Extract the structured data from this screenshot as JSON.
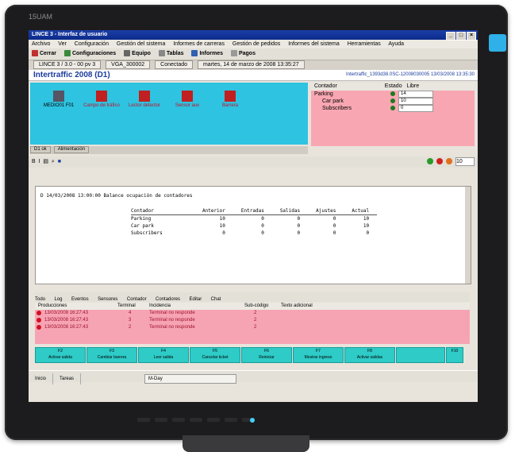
{
  "bezel_brand": "15UAM",
  "window": {
    "title": "LINCE 3 - Interfaz de usuario",
    "controls": [
      "_",
      "□",
      "×"
    ]
  },
  "menu": [
    "Archivo",
    "Ver",
    "Configuración",
    "Gestión del sistema",
    "Informes de carreras",
    "Gestión de pedidos",
    "Informes del sistema",
    "Herramientas",
    "Ayuda"
  ],
  "toolbar": {
    "items": [
      "Cerrar",
      "Configuraciones",
      "Equipo",
      "Tablas",
      "Informes",
      "Pagos"
    ]
  },
  "status_fields": [
    "LINCE 3 / 3.0 - 00 pv 3",
    "VGA_300002",
    "Conectado",
    "martes, 14 de marzo de 2008 13:35:27"
  ],
  "header": {
    "project_title": "Intertraffic 2008 (D1)",
    "project_id": "Intertraffic_1393d38.0SC-12008030005 13/03/2008 13:35:30"
  },
  "devices": [
    {
      "label": "MEDIO01 F01",
      "state": "ok"
    },
    {
      "label": "Campo de tráfico",
      "state": "error"
    },
    {
      "label": "Lector detector",
      "state": "error"
    },
    {
      "label": "Sensor aux",
      "state": "error"
    },
    {
      "label": "Barrera",
      "state": "error"
    }
  ],
  "counters": {
    "headers": [
      "Contador",
      "Estado",
      "Libre"
    ],
    "rows": [
      {
        "name": "Parking",
        "value": "14"
      },
      {
        "name": "Car park",
        "value": "10"
      },
      {
        "name": "Subscribers",
        "value": "0"
      }
    ]
  },
  "cyan_status": [
    "D1 ok",
    "Alimentación"
  ],
  "spin_value": "10",
  "log": {
    "line": "D 14/03/2008 13:00:00  Balance ocupación de contadores",
    "columns": [
      "Contador",
      "Anterior",
      "Entradas",
      "Salidas",
      "Ajustes",
      "Actual"
    ],
    "rows": [
      [
        "Parking",
        "10",
        "0",
        "0",
        "0",
        "10"
      ],
      [
        "Car park",
        "10",
        "0",
        "0",
        "0",
        "10"
      ],
      [
        "Subscribers",
        "0",
        "0",
        "0",
        "0",
        "0"
      ]
    ]
  },
  "tabs": [
    "Todo",
    "Log",
    "Eventos",
    "Sensores",
    "Contador",
    "Contadores",
    "Editar",
    "Chat"
  ],
  "alarms": {
    "headers": [
      "Producciones",
      "Terminal",
      "Incidencia",
      "Sub-código",
      "Texto adicional"
    ],
    "rows": [
      {
        "time": "13/03/2008 16:27:43",
        "terminal": "4",
        "incident": "Terminal no responde",
        "code": "2"
      },
      {
        "time": "13/03/2008 16:27:43",
        "terminal": "3",
        "incident": "Terminal no responde",
        "code": "2"
      },
      {
        "time": "13/03/2008 16:27:43",
        "terminal": "2",
        "incident": "Terminal no responde",
        "code": "2"
      }
    ]
  },
  "fkeys": [
    {
      "key": "F2",
      "label": "Activar salida"
    },
    {
      "key": "F3",
      "label": "Cambiar barrera"
    },
    {
      "key": "F4",
      "label": "Leer salida"
    },
    {
      "key": "F5",
      "label": "Cancelar ticket"
    },
    {
      "key": "F6",
      "label": "Reiniciar"
    },
    {
      "key": "F7",
      "label": "Mostrar ingreso"
    },
    {
      "key": "F8",
      "label": "Activar salidas"
    },
    {
      "key": "",
      "label": ""
    },
    {
      "key": "F10",
      "label": ""
    }
  ],
  "taskbar": {
    "items": [
      "Inicio",
      "Tareas"
    ],
    "active": "M-Day"
  },
  "colors": {
    "cyan": "#2ec3e0",
    "pink": "#f8a7b2",
    "title_blue": "#1b3fa8",
    "fkey": "#2ecbc7"
  }
}
